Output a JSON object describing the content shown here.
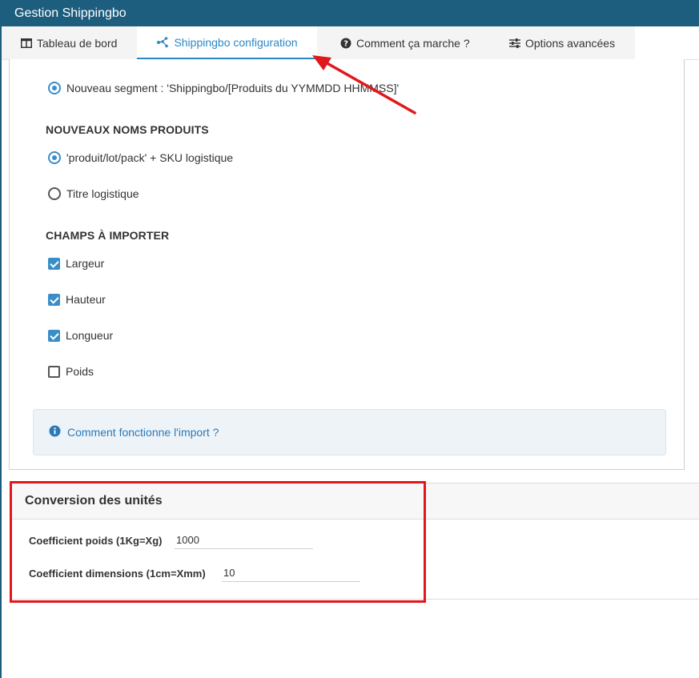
{
  "window": {
    "title": "Gestion Shippingbo"
  },
  "tabs": [
    {
      "label": "Tableau de bord",
      "icon": "table-icon",
      "active": false
    },
    {
      "label": "Shippingbo configuration",
      "icon": "network-icon",
      "active": true
    },
    {
      "label": "Comment ça marche ?",
      "icon": "question-circle-icon",
      "active": false
    },
    {
      "label": "Options avancées",
      "icon": "sliders-icon",
      "active": false
    }
  ],
  "segment": {
    "label": "Nouveau segment : 'Shippingbo/[Produits du YYMMDD HHMMSS]'",
    "selected": true
  },
  "product_names": {
    "heading": "NOUVEAUX NOMS PRODUITS",
    "options": [
      {
        "label": "'produit/lot/pack' + SKU logistique",
        "selected": true
      },
      {
        "label": "Titre logistique",
        "selected": false
      }
    ]
  },
  "import_fields": {
    "heading": "CHAMPS À IMPORTER",
    "options": [
      {
        "label": "Largeur",
        "checked": true
      },
      {
        "label": "Hauteur",
        "checked": true
      },
      {
        "label": "Longueur",
        "checked": true
      },
      {
        "label": "Poids",
        "checked": false
      }
    ]
  },
  "info": {
    "link": "Comment fonctionne l'import ?",
    "icon": "info-circle-icon"
  },
  "conversion": {
    "title": "Conversion des unités",
    "weight": {
      "label": "Coefficient poids (1Kg=Xg)",
      "value": "1000"
    },
    "dimensions": {
      "label": "Coefficient dimensions (1cm=Xmm)",
      "value": "10"
    }
  },
  "colors": {
    "header": "#1d5d7e",
    "accent": "#2a88c5",
    "annotation": "#e0181b"
  }
}
